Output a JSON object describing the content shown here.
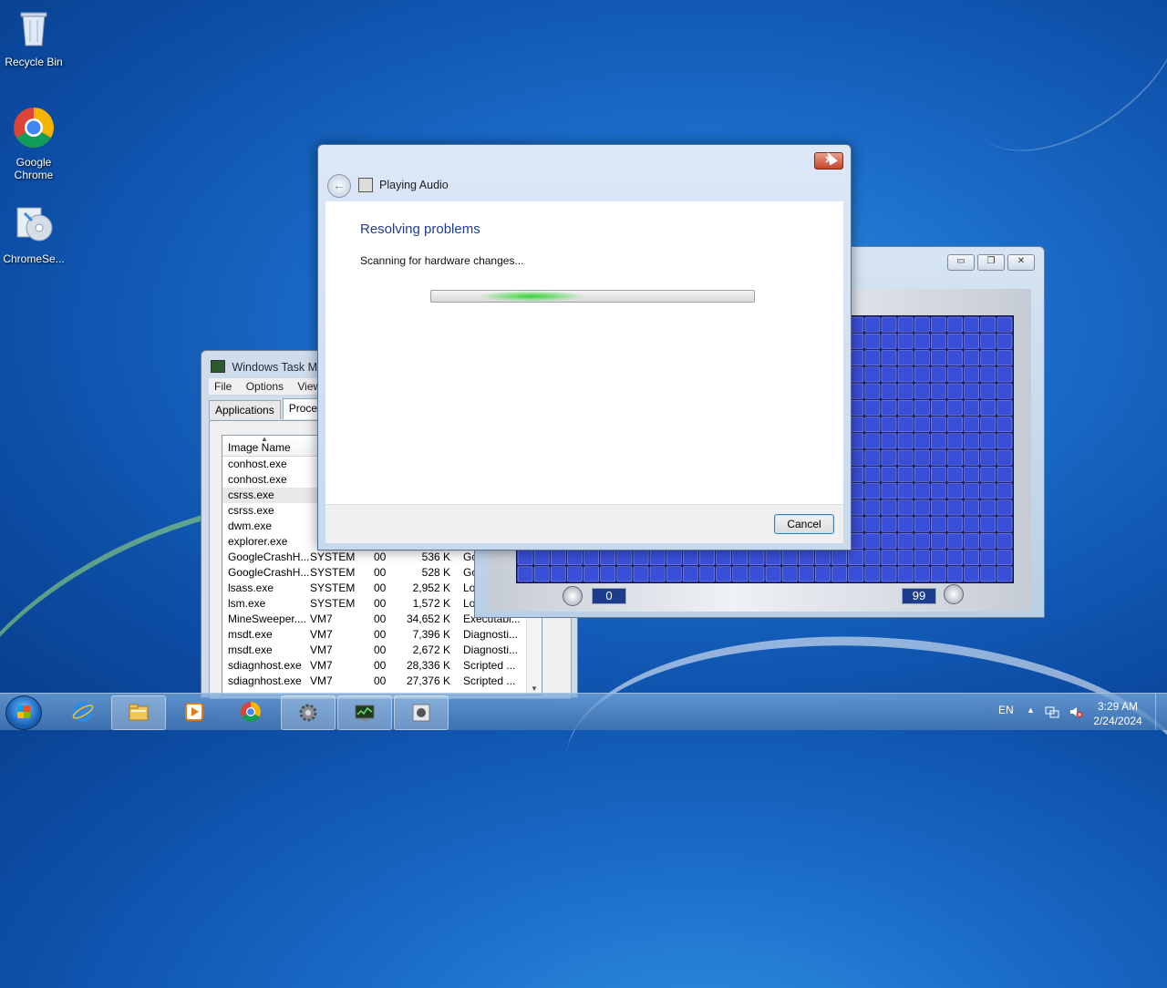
{
  "desktop": {
    "icons": [
      {
        "label": "Recycle Bin",
        "icon": "recycle-bin-icon"
      },
      {
        "label": "Google Chrome",
        "icon": "chrome-icon"
      },
      {
        "label": "ChromeSe...",
        "icon": "setup-disc-icon"
      }
    ]
  },
  "taskmgr": {
    "title": "Windows Task Ma",
    "menu": [
      "File",
      "Options",
      "View"
    ],
    "tabs": [
      "Applications",
      "Processe"
    ],
    "column_header": "Image Name",
    "rows": [
      {
        "name": "conhost.exe",
        "user": "",
        "cpu": "",
        "mem": "",
        "desc": ""
      },
      {
        "name": "conhost.exe",
        "user": "",
        "cpu": "",
        "mem": "",
        "desc": ""
      },
      {
        "name": "csrss.exe",
        "user": "",
        "cpu": "",
        "mem": "",
        "desc": ""
      },
      {
        "name": "csrss.exe",
        "user": "",
        "cpu": "",
        "mem": "",
        "desc": ""
      },
      {
        "name": "dwm.exe",
        "user": "",
        "cpu": "",
        "mem": "",
        "desc": ""
      },
      {
        "name": "explorer.exe",
        "user": "",
        "cpu": "",
        "mem": "",
        "desc": ""
      },
      {
        "name": "GoogleCrashH...",
        "user": "SYSTEM",
        "cpu": "00",
        "mem": "536 K",
        "desc": "Go"
      },
      {
        "name": "GoogleCrashH...",
        "user": "SYSTEM",
        "cpu": "00",
        "mem": "528 K",
        "desc": "Go"
      },
      {
        "name": "lsass.exe",
        "user": "SYSTEM",
        "cpu": "00",
        "mem": "2,952 K",
        "desc": "Loc"
      },
      {
        "name": "lsm.exe",
        "user": "SYSTEM",
        "cpu": "00",
        "mem": "1,572 K",
        "desc": "Loc"
      },
      {
        "name": "MineSweeper....",
        "user": "VM7",
        "cpu": "00",
        "mem": "34,652 K",
        "desc": "Executabl..."
      },
      {
        "name": "msdt.exe",
        "user": "VM7",
        "cpu": "00",
        "mem": "7,396 K",
        "desc": "Diagnosti..."
      },
      {
        "name": "msdt.exe",
        "user": "VM7",
        "cpu": "00",
        "mem": "2,672 K",
        "desc": "Diagnosti..."
      },
      {
        "name": "sdiagnhost.exe",
        "user": "VM7",
        "cpu": "00",
        "mem": "28,336 K",
        "desc": "Scripted ..."
      },
      {
        "name": "sdiagnhost.exe",
        "user": "VM7",
        "cpu": "00",
        "mem": "27,376 K",
        "desc": "Scripted ..."
      }
    ]
  },
  "minesweeper": {
    "controls": {
      "minimize": "▭",
      "restore": "❐",
      "close": "✕"
    },
    "timer_value": "0",
    "mines_value": "99",
    "grid": {
      "cols": 30,
      "rows": 16,
      "tile_color": "#3a4fd8"
    }
  },
  "dialog": {
    "close_glyph": "✕",
    "back_glyph": "←",
    "header_title": "Playing Audio",
    "main_title": "Resolving problems",
    "status": "Scanning for hardware changes...",
    "progress_state": "indeterminate",
    "cancel_label": "Cancel"
  },
  "taskbar": {
    "buttons": [
      {
        "name": "ie-icon",
        "open": false
      },
      {
        "name": "explorer-folder-icon",
        "open": true
      },
      {
        "name": "media-player-icon",
        "open": false
      },
      {
        "name": "chrome-icon",
        "open": false
      },
      {
        "name": "troubleshooter-icon",
        "open": true
      },
      {
        "name": "task-manager-icon",
        "open": true
      },
      {
        "name": "minesweeper-icon",
        "open": true
      }
    ],
    "language": "EN",
    "time": "3:29 AM",
    "date": "2/24/2024"
  }
}
